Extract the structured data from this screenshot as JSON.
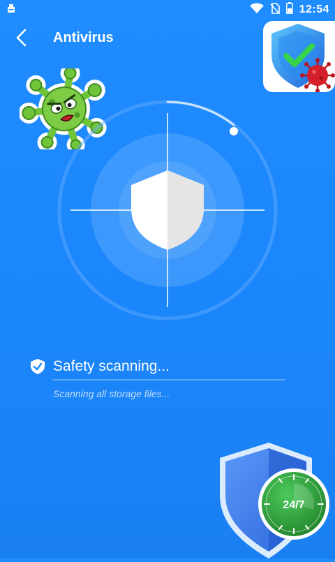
{
  "status_bar": {
    "time": "12:54",
    "icons": [
      "notification-icon",
      "wifi-icon",
      "no-sim-icon",
      "battery-icon"
    ]
  },
  "app_bar": {
    "title": "Antivirus",
    "back_icon": "chevron-left-icon"
  },
  "ad_badge": {
    "icon": "shield-check-virus-icon"
  },
  "sticker": {
    "icon": "virus-character-icon"
  },
  "scanner": {
    "center_icon": "shield-icon",
    "colors": {
      "background": "#1f8cff",
      "ring": "#7fbaff",
      "shield": "#ffffff"
    }
  },
  "scan_status": {
    "label": "Safety scanning...",
    "icon": "shield-check-icon",
    "sublabel": "Scanning all storage files...",
    "progress": 0
  },
  "promo": {
    "badge_text": "24/7",
    "icon": "shield-clock-icon",
    "colors": {
      "clock": "#3cb04a",
      "shield": "#3f7ff0"
    }
  }
}
